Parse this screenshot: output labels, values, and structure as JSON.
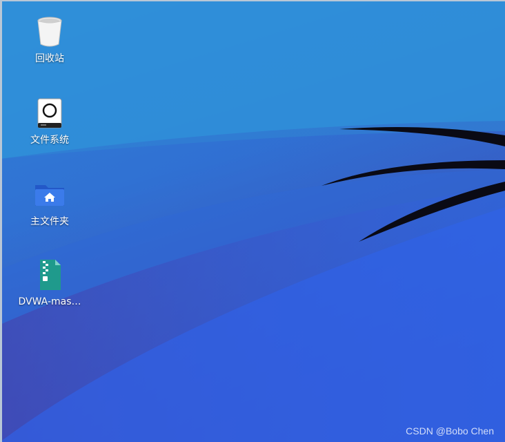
{
  "desktop": {
    "icons": [
      {
        "label": "回收站",
        "icon": "trash-icon"
      },
      {
        "label": "文件系统",
        "icon": "drive-icon"
      },
      {
        "label": "主文件夹",
        "icon": "home-folder-icon"
      },
      {
        "label": "DVWA-mas…",
        "icon": "zip-archive-icon"
      }
    ]
  },
  "watermark": "CSDN @Bobo Chen",
  "colors": {
    "wallpaper_top": "#2e86d6",
    "wallpaper_bottom": "#3a3fb0",
    "folder_blue": "#2f6fe0",
    "archive_teal": "#1f9a8c"
  }
}
